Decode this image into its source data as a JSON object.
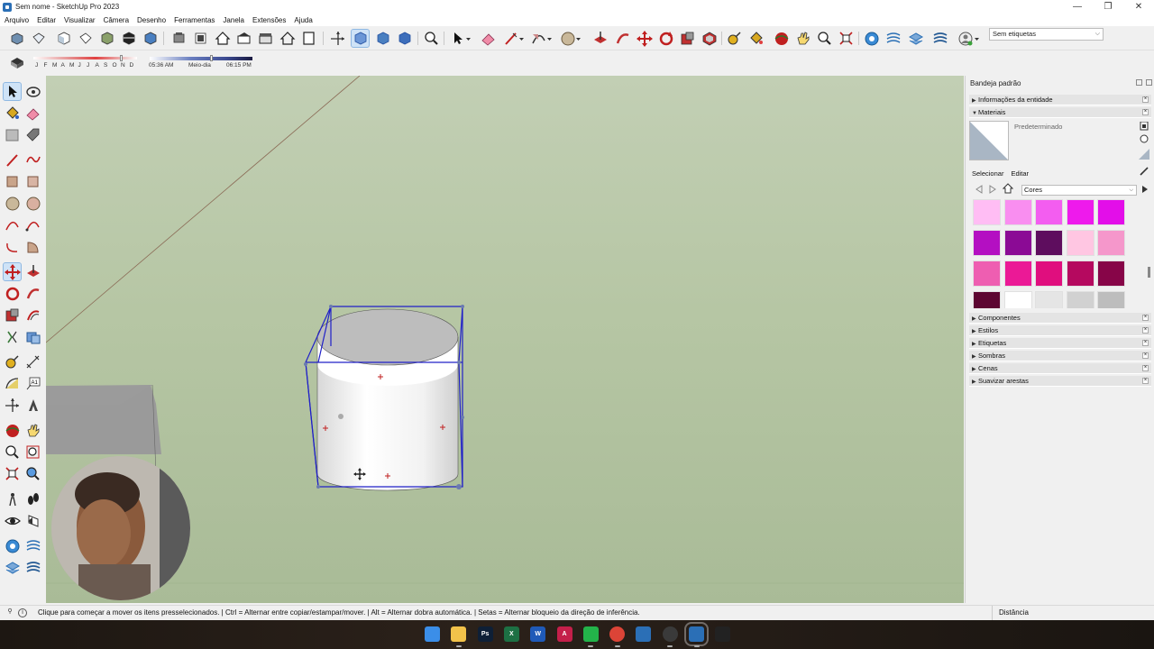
{
  "window": {
    "title": "Sem nome - SketchUp Pro 2023",
    "controls": [
      "—",
      "❐",
      "✕"
    ]
  },
  "menu": {
    "items": [
      "Arquivo",
      "Editar",
      "Visualizar",
      "Câmera",
      "Desenho",
      "Ferramentas",
      "Janela",
      "Extensões",
      "Ajuda"
    ]
  },
  "toolbar": {
    "tags_dropdown_value": "Sem etiquetas"
  },
  "shadows": {
    "months": [
      "J",
      "F",
      "M",
      "A",
      "M",
      "J",
      "J",
      "A",
      "S",
      "O",
      "N",
      "D"
    ],
    "sunrise": "05:36 AM",
    "noon": "Meio-dia",
    "sunset": "06:15 PM",
    "month_fraction": 0.84,
    "time_fraction": 0.6
  },
  "tray": {
    "title": "Bandeja padrão",
    "panels_top": [
      {
        "label": "Informações da entidade",
        "expanded": false
      },
      {
        "label": "Materiais",
        "expanded": true
      }
    ],
    "materials": {
      "current_name": "Predeterminado",
      "tabs": [
        "Selecionar",
        "Editar"
      ],
      "library": "Cores",
      "swatch_colors": [
        "#ffbdf4",
        "#f98ef0",
        "#f35df0",
        "#ee1aec",
        "#e30ee9",
        "#b40fc2",
        "#8b0a95",
        "#5e0d5e",
        "#ffc6e2",
        "#f597cb",
        "#ee5eb1",
        "#eb1996",
        "#e00e7e",
        "#b5095f",
        "#870548",
        "#5d0632",
        "#ffffff",
        "#e5e5e5",
        "#d1d1d1",
        "#bdbdbd"
      ]
    },
    "panels_bottom": [
      {
        "label": "Componentes"
      },
      {
        "label": "Estilos"
      },
      {
        "label": "Etiquetas"
      },
      {
        "label": "Sombras"
      },
      {
        "label": "Cenas"
      },
      {
        "label": "Suavizar arestas"
      }
    ]
  },
  "status": {
    "message": "Clique para começar a mover os itens presselecionados. | Ctrl = Alternar entre copiar/estampar/mover. | Alt = Alternar dobra automática. | Setas = Alternar bloqueio da direção de inferência.",
    "measurements_label": "Distância"
  },
  "colors": {
    "viewport_sky": "#c2cfb4",
    "selection": "#2020c8",
    "accent": "#2b6fb6"
  },
  "taskbar": {
    "apps": [
      {
        "name": "windows-start",
        "label": "",
        "color": "#3b8ee8"
      },
      {
        "name": "file-explorer",
        "label": "",
        "color": "#f2c24a"
      },
      {
        "name": "photoshop",
        "label": "Ps",
        "color": "#0e1f36"
      },
      {
        "name": "excel",
        "label": "X",
        "color": "#1d7044"
      },
      {
        "name": "word",
        "label": "W",
        "color": "#1f5ab8"
      },
      {
        "name": "affinity",
        "label": "A",
        "color": "#c41f4a"
      },
      {
        "name": "whatsapp",
        "label": "",
        "color": "#23b34a"
      },
      {
        "name": "chrome",
        "label": "",
        "color": "#dc4437"
      },
      {
        "name": "sketchup-a",
        "label": "",
        "color": "#2b6fb6"
      },
      {
        "name": "obs",
        "label": "",
        "color": "#3a3a3a"
      },
      {
        "name": "sketchup-b",
        "label": "",
        "color": "#2b6fb6"
      },
      {
        "name": "media",
        "label": "",
        "color": "#222222"
      }
    ]
  }
}
